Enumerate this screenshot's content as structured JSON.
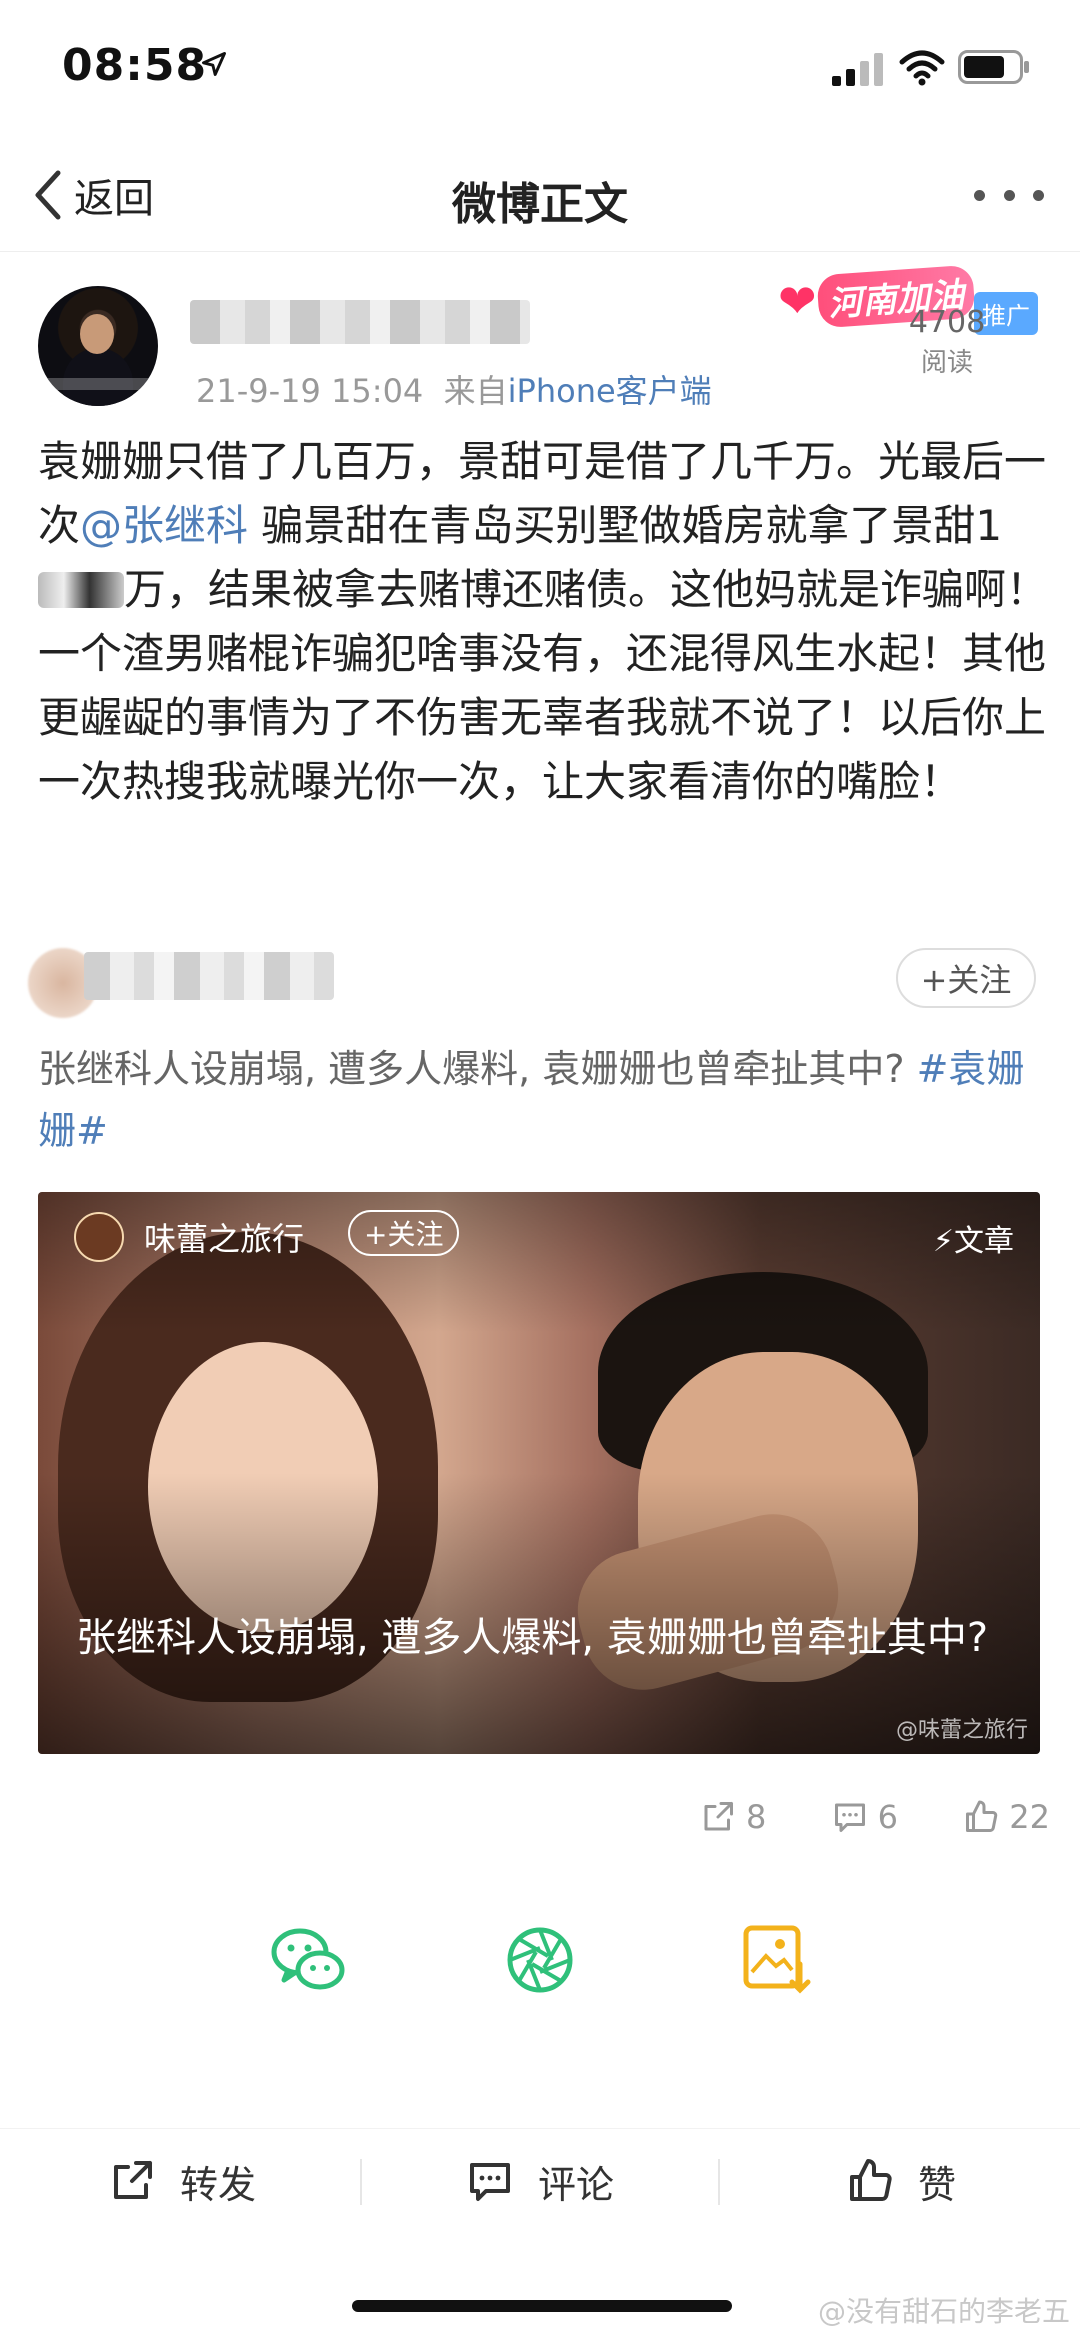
{
  "status_bar": {
    "time": "08:58"
  },
  "nav": {
    "back_label": "返回",
    "title": "微博正文"
  },
  "post": {
    "meta_date": "21-9-19 15:04",
    "meta_from": "来自",
    "meta_source": "iPhone客户端",
    "promo_text": "河南加油",
    "promo_badge": "推广",
    "read_count": "4708",
    "read_label": "阅读",
    "body_1": "袁姗姗只借了几百万，景甜可是借了几千万。光最后一次",
    "mention": "@张继科",
    "body_2": " 骗景甜在青岛买别墅做婚房就拿了景甜1",
    "body_3": "万，结果被拿去赌博还赌债。这他妈就是诈骗啊！一个渣男赌棍诈骗犯啥事没有，还混得风生水起！其他更龌龊的事情为了不伤害无辜者我就不说了！以后你上一次热搜我就曝光你一次，让大家看清你的嘴脸！"
  },
  "repost": {
    "follow_label": "+关注",
    "text": "张继科人设崩塌, 遭多人爆料, 袁姗姗也曾牵扯其中? ",
    "tag": "#袁姗姗#"
  },
  "card": {
    "author": "味蕾之旅行",
    "follow_label": "+关注",
    "type_label": "⚡文章",
    "title": "张继科人设崩塌, 遭多人爆料, 袁姗姗也曾牵扯其中?",
    "watermark": "@味蕾之旅行"
  },
  "stats": {
    "reposts": "8",
    "comments": "6",
    "likes": "22"
  },
  "actions": {
    "repost": "转发",
    "comment": "评论",
    "like": "赞"
  },
  "footer_watermark": "@没有甜石的李老五",
  "colors": {
    "link": "#4f7eb8",
    "wechat": "#2fc07a",
    "moments": "#2fc07a",
    "save": "#f3b21b"
  },
  "icons": [
    "location-arrow-icon",
    "signal-icon",
    "wifi-icon",
    "battery-icon",
    "chevron-left-icon",
    "more-icon",
    "share-out-icon",
    "comment-icon",
    "thumbs-up-icon",
    "wechat-icon",
    "moments-icon",
    "save-image-icon"
  ]
}
